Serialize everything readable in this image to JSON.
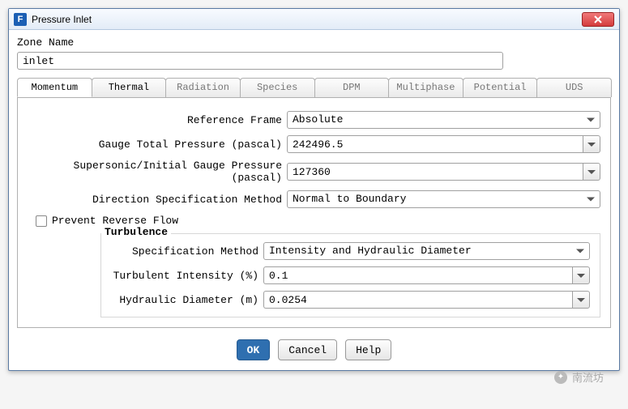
{
  "window": {
    "title": "Pressure Inlet",
    "icon_letter": "F"
  },
  "zone": {
    "label": "Zone Name",
    "value": "inlet"
  },
  "tabs": [
    {
      "label": "Momentum",
      "active": true
    },
    {
      "label": "Thermal"
    },
    {
      "label": "Radiation"
    },
    {
      "label": "Species"
    },
    {
      "label": "DPM"
    },
    {
      "label": "Multiphase"
    },
    {
      "label": "Potential"
    },
    {
      "label": "UDS"
    }
  ],
  "momentum": {
    "reference_frame": {
      "label": "Reference Frame",
      "value": "Absolute"
    },
    "gauge_total_pressure": {
      "label": "Gauge Total Pressure (pascal)",
      "value": "242496.5"
    },
    "supersonic_initial_gauge_pressure": {
      "label": "Supersonic/Initial Gauge Pressure (pascal)",
      "value": "127360"
    },
    "direction_spec_method": {
      "label": "Direction Specification Method",
      "value": "Normal to Boundary"
    },
    "prevent_reverse_flow": {
      "label": "Prevent Reverse Flow",
      "checked": false
    }
  },
  "turbulence": {
    "legend": "Turbulence",
    "spec_method": {
      "label": "Specification Method",
      "value": "Intensity and Hydraulic Diameter"
    },
    "turbulent_intensity": {
      "label": "Turbulent Intensity (%)",
      "value": "0.1"
    },
    "hydraulic_diameter": {
      "label": "Hydraulic Diameter (m)",
      "value": "0.0254"
    }
  },
  "buttons": {
    "ok": "OK",
    "cancel": "Cancel",
    "help": "Help"
  },
  "watermark": "南流坊"
}
